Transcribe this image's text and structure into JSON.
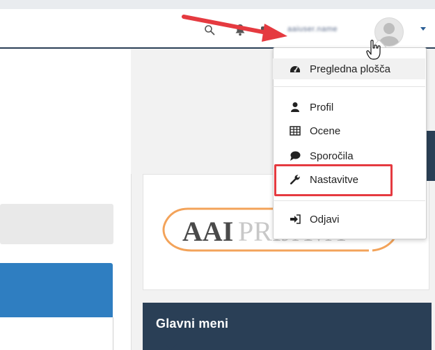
{
  "header": {
    "username": "aaiuser.name",
    "icons": [
      "search-icon",
      "bell-icon",
      "message-icon",
      "avatar",
      "chevron-down-icon"
    ]
  },
  "user_menu": {
    "items": [
      {
        "label": "Pregledna plošča",
        "icon": "dashboard-icon"
      },
      {
        "label": "Profil",
        "icon": "user-icon"
      },
      {
        "label": "Ocene",
        "icon": "table-icon"
      },
      {
        "label": "Sporočila",
        "icon": "chat-icon"
      },
      {
        "label": "Nastavitve",
        "icon": "wrench-icon"
      },
      {
        "label": "Odjavi",
        "icon": "logout-icon"
      }
    ],
    "highlighted": "Nastavitve"
  },
  "aai_logo": {
    "text_bold": "AAI",
    "text_light": "PRIJAVA"
  },
  "main_menu": {
    "title": "Glavni meni"
  },
  "colors": {
    "navy": "#2a3f56",
    "highlight_red": "#e53a40",
    "arrow_red": "#e53a40",
    "blue": "#2f7ec1",
    "logo_orange": "#f3a35a"
  }
}
